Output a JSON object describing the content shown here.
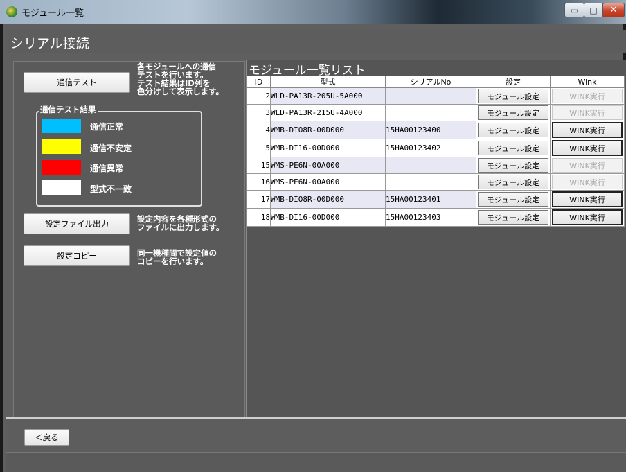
{
  "window": {
    "title": "モジュール一覧",
    "controls": {
      "minimize": "▭",
      "maximize": "□",
      "close": "✕"
    }
  },
  "header": {
    "title": "シリアル接続"
  },
  "left": {
    "comm_test_button": "通信テスト",
    "comm_test_desc": "各モジュールへの通信\nテストを行います。\nテスト結果はID列を\n色分けして表示します。",
    "legend": {
      "title": "通信テスト結果",
      "items": [
        {
          "label": "通信正常",
          "color": "#00bfff"
        },
        {
          "label": "通信不安定",
          "color": "#ffff00"
        },
        {
          "label": "通信異常",
          "color": "#ff0000"
        },
        {
          "label": "型式不一致",
          "color": "#ffffff"
        }
      ]
    },
    "export_button": "設定ファイル出力",
    "export_desc": "設定内容を各種形式の\nファイルに出力します。",
    "copy_button": "設定コピー",
    "copy_desc": "同一機種間で設定値の\nコピーを行います。"
  },
  "list": {
    "title": "モジュール一覧リスト",
    "columns": [
      "ID",
      "型式",
      "シリアルNo",
      "設定",
      "Wink"
    ],
    "rows": [
      {
        "id": "2",
        "model": "WLD-PA13R-205U-5A000",
        "serial": "",
        "setting": "モジュール設定",
        "wink": "WINK実行",
        "wink_enabled": false
      },
      {
        "id": "3",
        "model": "WLD-PA13R-215U-4A000",
        "serial": "",
        "setting": "モジュール設定",
        "wink": "WINK実行",
        "wink_enabled": false
      },
      {
        "id": "4",
        "model": "WMB-DIO8R-00D000",
        "serial": "15HA00123400",
        "setting": "モジュール設定",
        "wink": "WINK実行",
        "wink_enabled": true
      },
      {
        "id": "5",
        "model": "WMB-DI16-00D000",
        "serial": "15HA00123402",
        "setting": "モジュール設定",
        "wink": "WINK実行",
        "wink_enabled": true
      },
      {
        "id": "15",
        "model": "WMS-PE6N-00A000",
        "serial": "",
        "setting": "モジュール設定",
        "wink": "WINK実行",
        "wink_enabled": false
      },
      {
        "id": "16",
        "model": "WMS-PE6N-00A000",
        "serial": "",
        "setting": "モジュール設定",
        "wink": "WINK実行",
        "wink_enabled": false
      },
      {
        "id": "17",
        "model": "WMB-DIO8R-00D000",
        "serial": "15HA00123401",
        "setting": "モジュール設定",
        "wink": "WINK実行",
        "wink_enabled": true
      },
      {
        "id": "18",
        "model": "WMB-DI16-00D000",
        "serial": "15HA00123403",
        "setting": "モジュール設定",
        "wink": "WINK実行",
        "wink_enabled": true
      }
    ]
  },
  "footer": {
    "back_button": "＜戻る"
  }
}
